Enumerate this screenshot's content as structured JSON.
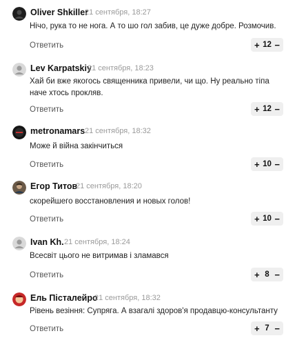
{
  "reply_label": "Ответить",
  "comments": [
    {
      "author": "Oliver Shkiller",
      "time": "21 сентября, 18:27",
      "text": "Нічо, рука то не нога. А то шо гол забив, це дуже добре. Розмочив.",
      "votes": "12",
      "avatar": "dark-avatar"
    },
    {
      "author": "Lev Karpatskiy",
      "time": "21 сентября, 18:23",
      "text": "Хай би вже якогось священника привели, чи що. Ну реально тіпа наче хтось прокляв.",
      "votes": "12",
      "avatar": "default-user-avatar"
    },
    {
      "author": "metronamars",
      "time": "21 сентября, 18:32",
      "text": "Може й війна закінчиться",
      "votes": "10",
      "avatar": "dark-logo-avatar"
    },
    {
      "author": "Егор Титов",
      "time": "21 сентября, 18:20",
      "text": "скорейшего восстановления и новых голов!",
      "votes": "10",
      "avatar": "photo-avatar"
    },
    {
      "author": "Ivan Kh.",
      "time": "21 сентября, 18:24",
      "text": "Всесвіт цього не витримав і зламався",
      "votes": "8",
      "avatar": "default-user-avatar"
    },
    {
      "author": "Ель Пісталейро",
      "time": "21 сентября, 18:32",
      "text": "Рівень везіння: Супряга. А взагалі здоров'я продавцю-консультанту",
      "votes": "7",
      "avatar": "character-avatar"
    }
  ],
  "vote_controls": {
    "plus": "+",
    "minus": "−"
  },
  "colors": {
    "vote_bg": "#efefef",
    "meta": "#9a9a9a"
  }
}
